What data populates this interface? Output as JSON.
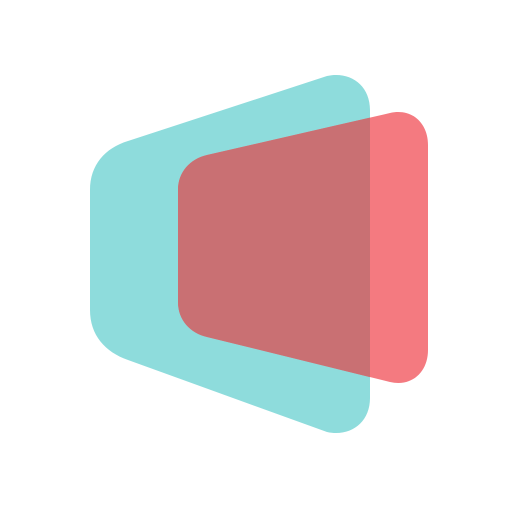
{
  "logo": {
    "icon": "overlapping-trapezoids-logo-icon",
    "colors": {
      "background": "#ffffff",
      "teal": "#8EDCDC",
      "coral": "#F47A80",
      "overlap": "#C97073"
    }
  }
}
